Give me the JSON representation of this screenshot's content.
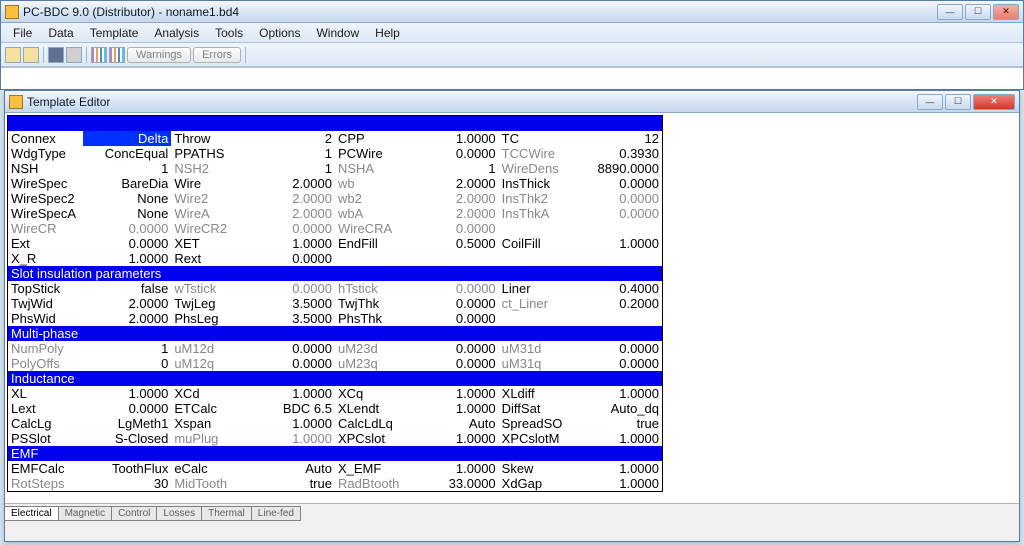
{
  "outer": {
    "title": "PC-BDC 9.0 (Distributor) - noname1.bd4",
    "menu": [
      "File",
      "Data",
      "Template",
      "Analysis",
      "Tools",
      "Options",
      "Window",
      "Help"
    ],
    "warnings": "Warnings",
    "errors": "Errors"
  },
  "editor": {
    "title": "Template Editor",
    "tabs": [
      "Electrical",
      "Magnetic",
      "Control",
      "Losses",
      "Thermal",
      "Line-fed"
    ]
  },
  "sections": {
    "top": [
      [
        "Connex",
        "Delta",
        "Throw",
        "2",
        "CPP",
        "1.0000",
        "TC",
        "12",
        false,
        true,
        false,
        false,
        false,
        false,
        false,
        false
      ],
      [
        "WdgType",
        "ConcEqual",
        "PPATHS",
        "1",
        "PCWire",
        "0.0000",
        "TCCWire",
        "0.3930",
        false,
        false,
        false,
        false,
        false,
        false,
        true,
        false
      ],
      [
        "NSH",
        "1",
        "NSH2",
        "1",
        "NSHA",
        "1",
        "WireDens",
        "8890.0000",
        false,
        false,
        true,
        false,
        true,
        false,
        true,
        false
      ],
      [
        "WireSpec",
        "BareDia",
        "Wire",
        "2.0000",
        "wb",
        "2.0000",
        "InsThick",
        "0.0000",
        false,
        false,
        false,
        false,
        true,
        false,
        false,
        false
      ],
      [
        "WireSpec2",
        "None",
        "Wire2",
        "2.0000",
        "wb2",
        "2.0000",
        "InsThk2",
        "0.0000",
        false,
        false,
        true,
        true,
        true,
        true,
        true,
        true
      ],
      [
        "WireSpecA",
        "None",
        "WireA",
        "2.0000",
        "wbA",
        "2.0000",
        "InsThkA",
        "0.0000",
        false,
        false,
        true,
        true,
        true,
        true,
        true,
        true
      ],
      [
        "WireCR",
        "0.0000",
        "WireCR2",
        "0.0000",
        "WireCRA",
        "0.0000",
        "",
        "",
        true,
        true,
        true,
        true,
        true,
        true,
        false,
        false
      ],
      [
        "Ext",
        "0.0000",
        "XET",
        "1.0000",
        "EndFill",
        "0.5000",
        "CoilFill",
        "1.0000",
        false,
        false,
        false,
        false,
        false,
        false,
        false,
        false
      ],
      [
        "X_R",
        "1.0000",
        "Rext",
        "0.0000",
        "",
        "",
        "",
        "",
        false,
        false,
        false,
        false,
        false,
        false,
        false,
        false
      ]
    ],
    "slot_head": "Slot insulation parameters",
    "slot": [
      [
        "TopStick",
        "false",
        "wTstick",
        "0.0000",
        "hTstick",
        "0.0000",
        "Liner",
        "0.4000",
        false,
        false,
        true,
        true,
        true,
        true,
        false,
        false
      ],
      [
        "TwjWid",
        "2.0000",
        "TwjLeg",
        "3.5000",
        "TwjThk",
        "0.0000",
        "ct_Liner",
        "0.2000",
        false,
        false,
        false,
        false,
        false,
        false,
        true,
        false
      ],
      [
        "PhsWid",
        "2.0000",
        "PhsLeg",
        "3.5000",
        "PhsThk",
        "0.0000",
        "",
        "",
        false,
        false,
        false,
        false,
        false,
        false,
        false,
        false
      ]
    ],
    "multi_head": "Multi-phase",
    "multi": [
      [
        "NumPoly",
        "1",
        "uM12d",
        "0.0000",
        "uM23d",
        "0.0000",
        "uM31d",
        "0.0000",
        true,
        false,
        true,
        false,
        true,
        false,
        true,
        false
      ],
      [
        "PolyOffs",
        "0",
        "uM12q",
        "0.0000",
        "uM23q",
        "0.0000",
        "uM31q",
        "0.0000",
        true,
        false,
        true,
        false,
        true,
        false,
        true,
        false
      ]
    ],
    "ind_head": "Inductance",
    "ind": [
      [
        "XL",
        "1.0000",
        "XCd",
        "1.0000",
        "XCq",
        "1.0000",
        "XLdiff",
        "1.0000",
        false,
        false,
        false,
        false,
        false,
        false,
        false,
        false
      ],
      [
        "Lext",
        "0.0000",
        "ETCalc",
        "BDC 6.5",
        "XLendt",
        "1.0000",
        "DiffSat",
        "Auto_dq",
        false,
        false,
        false,
        false,
        false,
        false,
        false,
        false
      ],
      [
        "CalcLg",
        "LgMeth1",
        "Xspan",
        "1.0000",
        "CalcLdLq",
        "Auto",
        "SpreadSO",
        "true",
        false,
        false,
        false,
        false,
        false,
        false,
        false,
        false
      ],
      [
        "PSSlot",
        "S-Closed",
        "muPlug",
        "1.0000",
        "XPCslot",
        "1.0000",
        "XPCslotM",
        "1.0000",
        false,
        false,
        true,
        true,
        false,
        false,
        false,
        false
      ]
    ],
    "emf_head": "EMF",
    "emf": [
      [
        "EMFCalc",
        "ToothFlux",
        "eCalc",
        "Auto",
        "X_EMF",
        "1.0000",
        "Skew",
        "1.0000",
        false,
        false,
        false,
        false,
        false,
        false,
        false,
        false
      ],
      [
        "RotSteps",
        "30",
        "MidTooth",
        "true",
        "RadBtooth",
        "33.0000",
        "XdGap",
        "1.0000",
        true,
        false,
        true,
        false,
        true,
        false,
        false,
        false
      ]
    ]
  }
}
